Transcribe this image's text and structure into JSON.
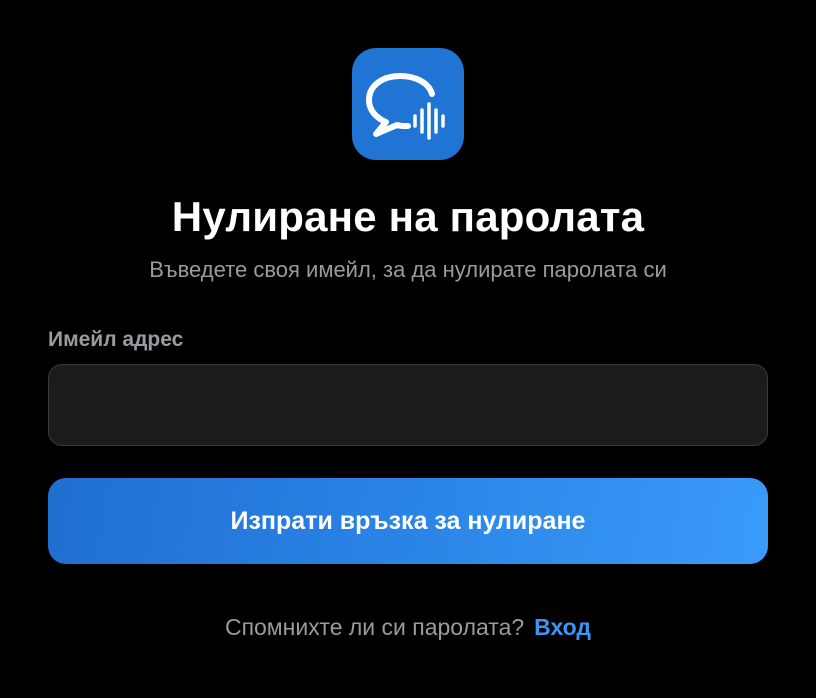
{
  "app": {
    "icon_name": "chat-bubble-voice-icon",
    "icon_background": "#1f74d4"
  },
  "header": {
    "title": "Нулиране на паролата",
    "subtitle": "Въведете своя имейл, за да нулирате паролата си"
  },
  "form": {
    "email_label": "Имейл адрес",
    "email_value": "",
    "submit_label": "Изпрати връзка за нулиране"
  },
  "footer": {
    "prompt": "Спомнихте ли си паролата?",
    "login_link": "Вход"
  },
  "colors": {
    "background": "#000000",
    "accent": "#3a95f5",
    "button_gradient_start": "#1f6fd1",
    "button_gradient_end": "#3a9bfa",
    "input_background": "#1c1c1e",
    "muted_text": "#9a9aa0"
  }
}
